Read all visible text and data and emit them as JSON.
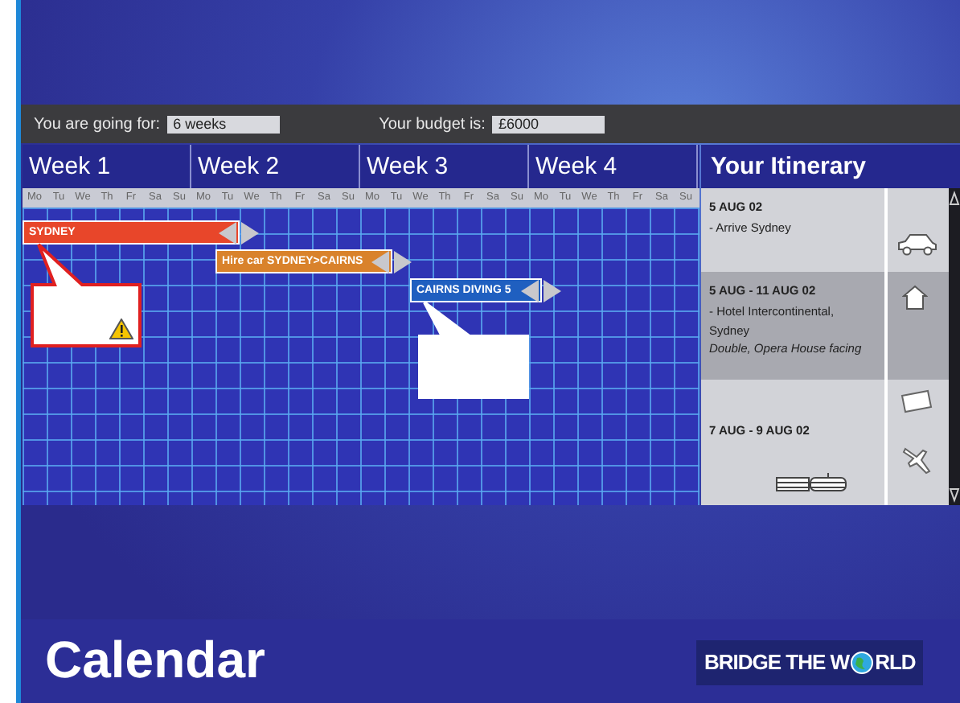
{
  "trip": {
    "duration_label": "You are going for:",
    "duration": "6 weeks",
    "budget_label": "Your budget is:",
    "budget": "£6000"
  },
  "weeks": [
    {
      "label": "Week 1",
      "days": [
        "Mo",
        "Tu",
        "We",
        "Th",
        "Fr",
        "Sa",
        "Su"
      ]
    },
    {
      "label": "Week 2",
      "days": [
        "Mo",
        "Tu",
        "We",
        "Th",
        "Fr",
        "Sa",
        "Su"
      ]
    },
    {
      "label": "Week 3",
      "days": [
        "Mo",
        "Tu",
        "We",
        "Th",
        "Fr",
        "Sa",
        "Su"
      ]
    },
    {
      "label": "Week 4",
      "days": [
        "Mo",
        "Tu",
        "We",
        "Th",
        "Fr",
        "Sa",
        "Su"
      ]
    }
  ],
  "events": [
    {
      "label": "SYDNEY",
      "color": "#e8462a",
      "callout": true,
      "warning": true
    },
    {
      "label": "Hire car SYDNEY>CAIRNS",
      "color": "#d9822b",
      "callout": false
    },
    {
      "label": "CAIRNS DIVING 5",
      "color": "#1f5fc0",
      "callout": true,
      "warning": false
    }
  ],
  "itinerary": {
    "title": "Your Itinerary",
    "entries": [
      {
        "kind": "transfer",
        "date": "5 AUG 02",
        "lines": [
          "- Arrive Sydney"
        ],
        "selected": false
      },
      {
        "kind": "hotel",
        "date": "5 AUG - 11 AUG 02",
        "lines": [
          "- Hotel Intercontinental,",
          "Sydney"
        ],
        "note": "Double, Opera House facing",
        "selected": true
      },
      {
        "kind": "transport",
        "date": "7 AUG - 9 AUG 02",
        "selected": false
      }
    ]
  },
  "footer": {
    "title": "Calendar",
    "logo_before": "BRIDGE THE W",
    "logo_after": "RLD"
  }
}
